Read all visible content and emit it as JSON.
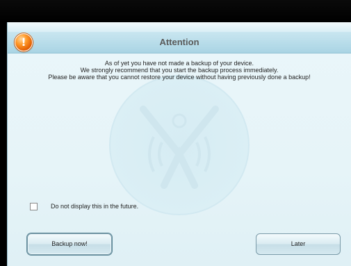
{
  "dialog": {
    "title": "Attention",
    "icon": "warning-icon",
    "icon_glyph": "!",
    "message_lines": [
      "As of yet you have not made a backup of your device.",
      "We strongly recommend that you start the backup process immediately.",
      "Please be aware that you cannot restore your device without having previously done a backup!"
    ],
    "checkbox_label": "Do not display this in the future.",
    "checkbox_checked": false,
    "buttons": {
      "backup": "Backup now!",
      "later": "Later"
    }
  },
  "colors": {
    "accent_orange": "#ff8a1a",
    "header_blue": "#b4dae8",
    "background": "#e6f4f8"
  }
}
